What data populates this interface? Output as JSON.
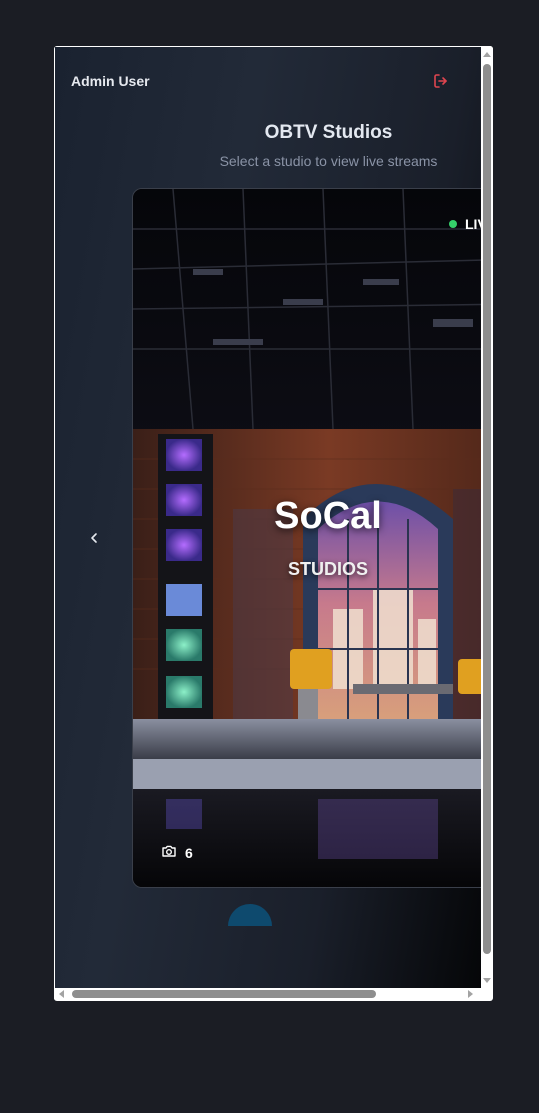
{
  "header": {
    "user_name": "Admin User",
    "logout_icon": "logout-icon",
    "logout_color": "#e0454f"
  },
  "page": {
    "title": "OBTV Studios",
    "subtitle": "Select a studio to view live streams"
  },
  "carousel": {
    "prev_icon": "chevron-left-icon",
    "card": {
      "live_label": "LIVE",
      "live_color": "#35d06a",
      "studio_name": "SoCal",
      "studio_sub": "STUDIOS",
      "photo_icon": "camera-icon",
      "photo_count": "6"
    }
  },
  "colors": {
    "page_bg": "#1b1d24",
    "loader": "#0e4a6e"
  }
}
